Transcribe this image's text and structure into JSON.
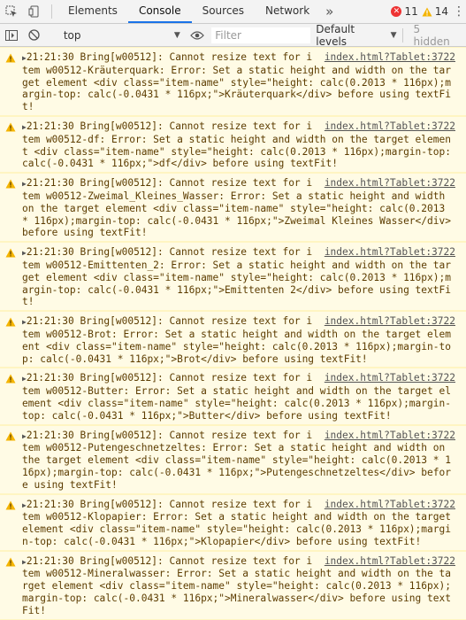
{
  "tabbar": {
    "tabs": [
      "Elements",
      "Console",
      "Sources",
      "Network"
    ],
    "active_tab": "Console",
    "more": "»",
    "error_count": "11",
    "warning_count": "14"
  },
  "toolbar": {
    "context": "top",
    "filter_placeholder": "Filter",
    "levels": "Default levels",
    "hidden": "5 hidden"
  },
  "messages": [
    {
      "text": "21:21:30 Bring[w00512]: Cannot resize text for item w00512-Kräuterquark: Error: Set a static height and width on the target element <div class=\"item-name\" style=\"height: calc(0.2013 * 116px);margin-top: calc(-0.0431 * 116px;\">Kräuterquark</div> before using textFit!",
      "source": "index.html?Tablet:3722"
    },
    {
      "text": "21:21:30 Bring[w00512]: Cannot resize text for item w00512-df: Error: Set a static height and width on the target element <div class=\"item-name\" style=\"height: calc(0.2013 * 116px);margin-top: calc(-0.0431 * 116px;\">df</div> before using textFit!",
      "source": "index.html?Tablet:3722"
    },
    {
      "text": "21:21:30 Bring[w00512]: Cannot resize text for item w00512-Zweimal_Kleines_Wasser: Error: Set a static height and width on the target element <div class=\"item-name\" style=\"height: calc(0.2013 * 116px);margin-top: calc(-0.0431 * 116px;\">Zweimal Kleines Wasser</div> before using textFit!",
      "source": "index.html?Tablet:3722"
    },
    {
      "text": "21:21:30 Bring[w00512]: Cannot resize text for item w00512-Emittenten_2: Error: Set a static height and width on the target element <div class=\"item-name\" style=\"height: calc(0.2013 * 116px);margin-top: calc(-0.0431 * 116px;\">Emittenten 2</div> before using textFit!",
      "source": "index.html?Tablet:3722"
    },
    {
      "text": "21:21:30 Bring[w00512]: Cannot resize text for item w00512-Brot: Error: Set a static height and width on the target element <div class=\"item-name\" style=\"height: calc(0.2013 * 116px);margin-top: calc(-0.0431 * 116px;\">Brot</div> before using textFit!",
      "source": "index.html?Tablet:3722"
    },
    {
      "text": "21:21:30 Bring[w00512]: Cannot resize text for item w00512-Butter: Error: Set a static height and width on the target element <div class=\"item-name\" style=\"height: calc(0.2013 * 116px);margin-top: calc(-0.0431 * 116px;\">Butter</div> before using textFit!",
      "source": "index.html?Tablet:3722"
    },
    {
      "text": "21:21:30 Bring[w00512]: Cannot resize text for item w00512-Putengeschnetzeltes: Error: Set a static height and width on the target element <div class=\"item-name\" style=\"height: calc(0.2013 * 116px);margin-top: calc(-0.0431 * 116px;\">Putengeschnetzeltes</div> before using textFit!",
      "source": "index.html?Tablet:3722"
    },
    {
      "text": "21:21:30 Bring[w00512]: Cannot resize text for item w00512-Klopapier: Error: Set a static height and width on the target element <div class=\"item-name\" style=\"height: calc(0.2013 * 116px);margin-top: calc(-0.0431 * 116px;\">Klopapier</div> before using textFit!",
      "source": "index.html?Tablet:3722"
    },
    {
      "text": "21:21:30 Bring[w00512]: Cannot resize text for item w00512-Mineralwasser: Error: Set a static height and width on the target element <div class=\"item-name\" style=\"height: calc(0.2013 * 116px);margin-top: calc(-0.0431 * 116px;\">Mineralwasser</div> before using textFit!",
      "source": "index.html?Tablet:3722"
    }
  ],
  "colors": {
    "warning_bg": "#fffbe5",
    "warning_text": "#5c3c00",
    "active_tab_accent": "#1a73e8",
    "error_red": "#e33",
    "warning_yellow": "#f4b400"
  },
  "icons": {
    "inspect": "inspect-element-icon",
    "device": "device-toolbar-icon",
    "sidebar": "sidebar-toggle-icon",
    "clear": "clear-console-icon",
    "eye": "live-expression-icon",
    "warning": "warning-icon"
  }
}
